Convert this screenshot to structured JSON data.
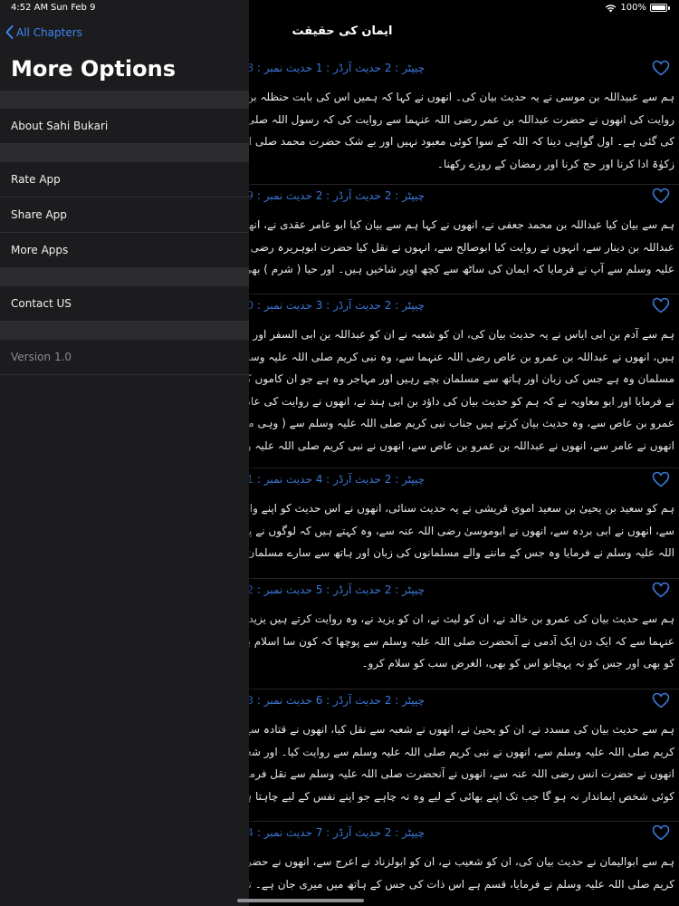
{
  "status_bar": {
    "time": "4:52 AM",
    "date": "Sun Feb 9",
    "battery": "100%"
  },
  "colors": {
    "accent": "#3e86f5",
    "sidebar_bg": "#1c1c1e",
    "section_gap": "#2c2c2e",
    "link": "#3b78d8"
  },
  "sidebar": {
    "back_label": "All Chapters",
    "title": "More Options",
    "items": [
      "About Sahi Bukari",
      "Rate App",
      "Share App",
      "More Apps",
      "Contact US",
      "Version 1.0"
    ]
  },
  "reader": {
    "title": "ایمان کی حقیقت",
    "hadiths": [
      {
        "ref": "چیپٹر : 2 حدیث آرڈر : 1 حدیث نمبر : 8",
        "lines": [
          "ہم سے عبیداللہ بن موسی نے یہ حدیث بیان کی۔ انھوں نے کہا کہ ہمیں اس کی بابت حنظلہ بن ابی",
          "روایت کی انھوں نے حضرت عبداللہ بن عمر رضی اللہ عنہما سے روایت کی کہ رسول اللہ صلی اللہ",
          "کی گئی ہے۔ اول گواہی دینا کہ اللہ کے سوا کوئی معبود نہیں اور بے شک حضرت محمد صلی اللہ ع",
          "زکوٰۃ ادا کرنا اور حج کرنا اور رمضان کے روزے رکھنا۔"
        ]
      },
      {
        "ref": "چیپٹر : 2 حدیث آرڈر : 2 حدیث نمبر : 9",
        "lines": [
          "ہم سے بیان کیا عبداللہ بن محمد جعفی نے، انھوں نے کہا ہم سے بیان کیا ابو عامر عقدی نے، انھو",
          "عبداللہ بن دینار سے، انہوں نے روایت کیا ابوصالح سے، انہوں نے نقل کیا حضرت ابوہریرہ رضی اللہ",
          "علیہ وسلم سے آپ نے فرمایا کہ ایمان کی ساٹھ سے کچھ اوپر شاخیں ہیں۔ اور حیا ( شرم ) بھی ایما"
        ]
      },
      {
        "ref": "چیپٹر : 2 حدیث آرڈر : 3 حدیث نمبر : 10",
        "lines": [
          "ہم سے آدم بن ابی ایاس نے یہ حدیث بیان کی، ان کو شعبہ نے ان کو عبداللہ بن ابی السفر اور اسماعیل",
          "ہیں، انھوں نے عبداللہ بن عمرو بن عاص رضی اللہ عنہما سے، وہ نبی کریم صلی اللہ علیہ وسلم سے",
          "مسلمان وہ ہے جس کی زبان اور ہاتھ سے مسلمان بچے رہیں اور مہاجر وہ ہے جو ان کاموں کو چھوڑ",
          "نے فرمایا اور ابو معاویہ نے کہ ہم کو حدیث بیان کی داؤد بن ابی ہند نے، انھوں نے روایت کی عامر س",
          "عمرو بن عاص سے، وہ حدیث بیان کرتے ہیں جناب نبی کریم صلی اللہ علیہ وسلم سے ( وہی مذکور",
          "انھوں نے عامر سے، انھوں نے عبداللہ بن عمرو بن عاص سے، انھوں نے نبی کریم صلی اللہ علیہ وس"
        ]
      },
      {
        "ref": "چیپٹر : 2 حدیث آرڈر : 4 حدیث نمبر : 11",
        "lines": [
          "ہم کو سعید بن یحییٰ بن سعید اموی قریشی نے یہ حدیث سنائی، انھوں نے اس حدیث کو اپنے وال",
          "سے، انھوں نے ابی بردہ سے، انھوں نے ابوموسیٰ رضی اللہ عنہ سے، وہ کہتے ہیں کہ لوگوں نے پوچ",
          "اللہ علیہ وسلم نے فرمایا وہ جس کے ماننے والے مسلمانوں کی زبان اور ہاتھ سے سارے مسلمان سلا"
        ]
      },
      {
        "ref": "چیپٹر : 2 حدیث آرڈر : 5 حدیث نمبر : 12",
        "lines": [
          "ہم سے حدیث بیان کی عمرو بن خالد نے، ان کو لیث نے، ان کو یزید نے، وہ روایت کرتے ہیں یزید سے، وہ ابوالخیر",
          "عنہما سے کہ ایک دن ایک آدمی نے آنحضرت صلی اللہ علیہ وسلم سے پوچھا کہ کون سا اسلام بہ",
          "کو بھی اور جس کو نہ پہچانو اس کو بھی، الغرض سب کو سلام کرو۔"
        ]
      },
      {
        "ref": "چیپٹر : 2 حدیث آرڈر : 6 حدیث نمبر : 13",
        "lines": [
          "ہم سے حدیث بیان کی مسدد نے، ان کو یحییٰ نے، انھوں نے شعبہ سے نقل کیا، انھوں نے قتادہ سے",
          "کریم صلی اللہ علیہ وسلم سے، انھوں نے نبی کریم صلی اللہ علیہ وسلم سے روایت کیا۔ اور شعبہ نے",
          "انھوں نے حضرت انس رضی اللہ عنہ سے، انھوں نے آنحضرت صلی اللہ علیہ وسلم سے نقل فرمایا ک",
          "کوئی شخص ایماندار نہ ہو گا جب تک اپنے بھائی کے لیے وہ نہ چاہے جو اپنے نفس کے لیے چاہتا ہے"
        ]
      },
      {
        "ref": "چیپٹر : 2 حدیث آرڈر : 7 حدیث نمبر : 14",
        "lines": [
          "ہم سے ابوالیمان نے حدیث بیان کی، ان کو شعیب نے، ان کو ابولزناد نے اعرج سے، انھوں نے حضر",
          "کریم صلی اللہ علیہ وسلم نے فرمایا، قسم ہے اس ذات کی جس کے ہاتھ میں میری جان ہے۔ تم میں"
        ]
      }
    ]
  }
}
